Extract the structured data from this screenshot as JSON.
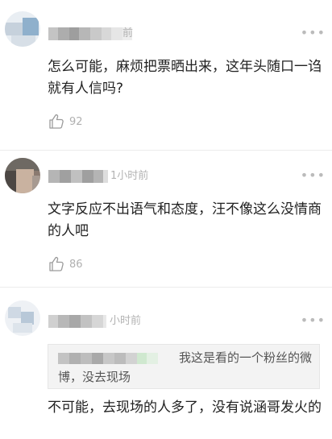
{
  "comments": [
    {
      "time": "前",
      "text": "怎么可能，麻烦把票晒出来，这年头随口一诌就有人信吗?",
      "likes": "92",
      "more_icon": "ellipsis-icon"
    },
    {
      "time": "1小时前",
      "text": "文字反应不出语气和态度，汪不像这么没情商的人吧",
      "likes": "86",
      "more_icon": "ellipsis-icon"
    },
    {
      "time": "小时前",
      "quote_text": "我这是看的一个粉丝的微博，没去现场",
      "text": "不可能，去现场的人多了，没有说涵哥发火的",
      "more_icon": "ellipsis-icon"
    }
  ],
  "colors": {
    "text": "#222222",
    "meta": "#b3b3b3",
    "divider": "#ececec",
    "quote_bg": "#f3f3f3"
  }
}
